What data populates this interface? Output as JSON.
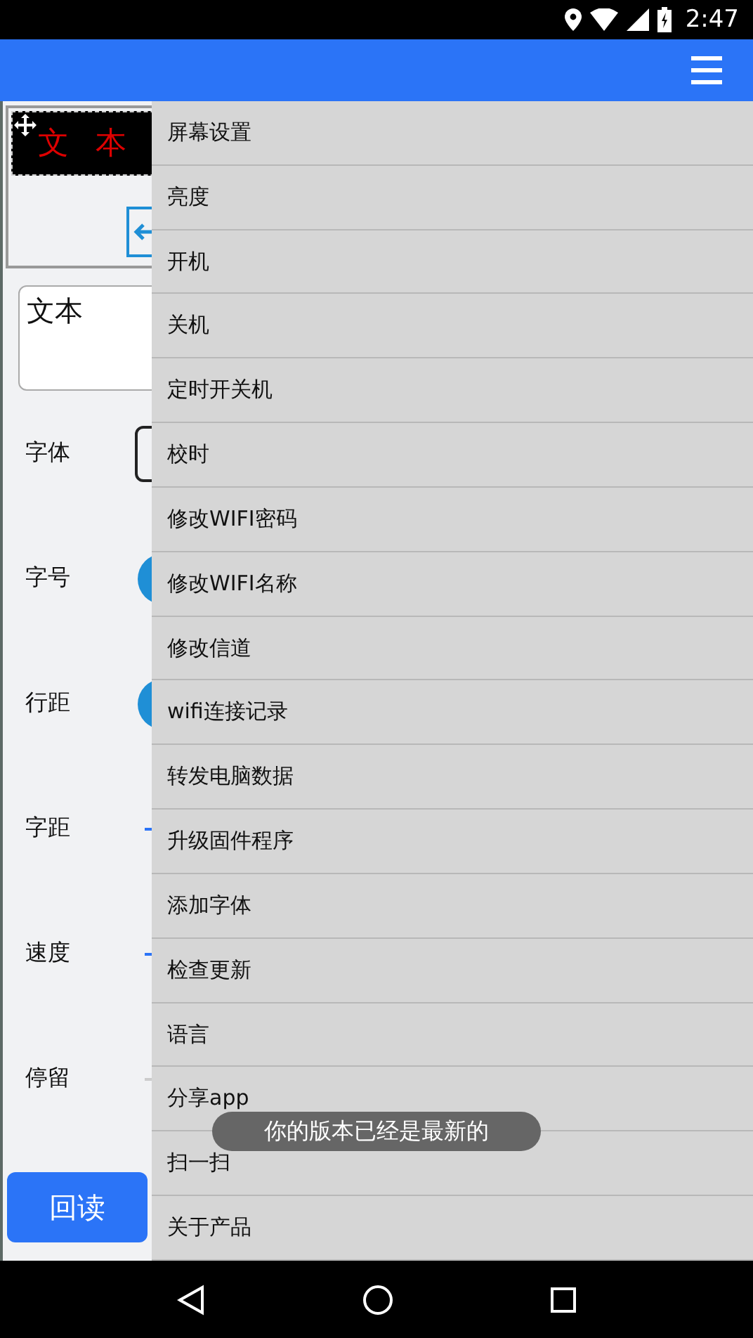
{
  "status_bar": {
    "time": "2:47"
  },
  "preview": {
    "led_text": "文 本"
  },
  "text_input": {
    "value": "文本"
  },
  "settings": [
    {
      "label": "字体",
      "kind": "select"
    },
    {
      "label": "字号",
      "kind": "knob"
    },
    {
      "label": "行距",
      "kind": "knob"
    },
    {
      "label": "字距",
      "kind": "track"
    },
    {
      "label": "速度",
      "kind": "track"
    },
    {
      "label": "停留",
      "kind": "faint"
    }
  ],
  "readback_button": "回读",
  "menu": [
    "屏幕设置",
    "亮度",
    "开机",
    "关机",
    "定时开关机",
    "校时",
    "修改WIFI密码",
    "修改WIFI名称",
    "修改信道",
    "wifi连接记录",
    "转发电脑数据",
    "升级固件程序",
    "添加字体",
    "检查更新",
    "语言",
    "分享app",
    "扫一扫",
    "关于产品"
  ],
  "toast": "你的版本已经是最新的"
}
